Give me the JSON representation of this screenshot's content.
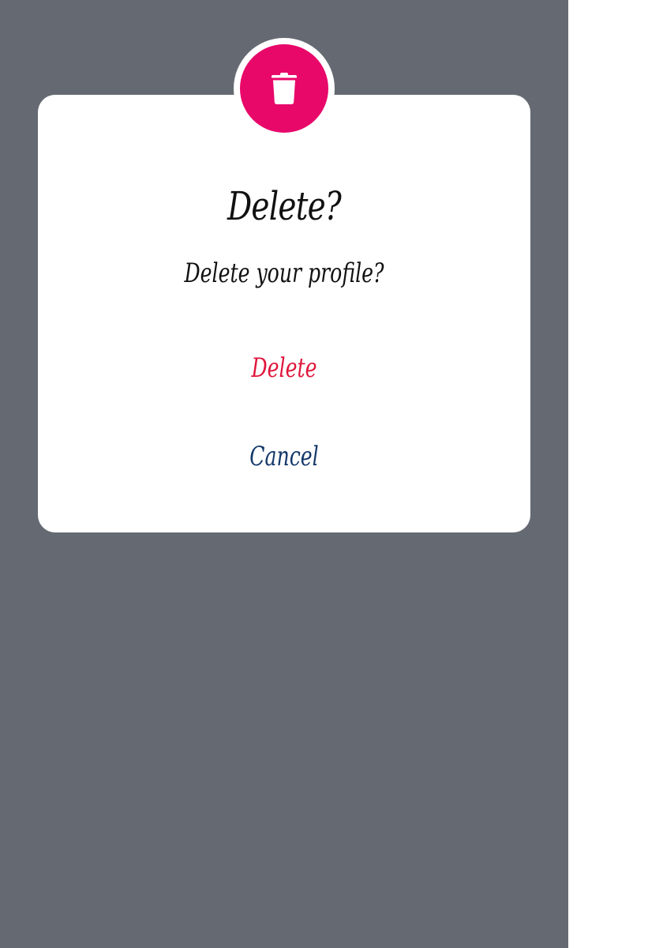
{
  "dialog": {
    "title": "Delete?",
    "message": "Delete your profile?",
    "confirm_label": "Delete",
    "cancel_label": "Cancel",
    "icon": "trash-icon"
  },
  "colors": {
    "overlay": "#656a72",
    "icon_background": "#e8086a",
    "confirm_text": "#e0163c",
    "cancel_text": "#14386a"
  }
}
